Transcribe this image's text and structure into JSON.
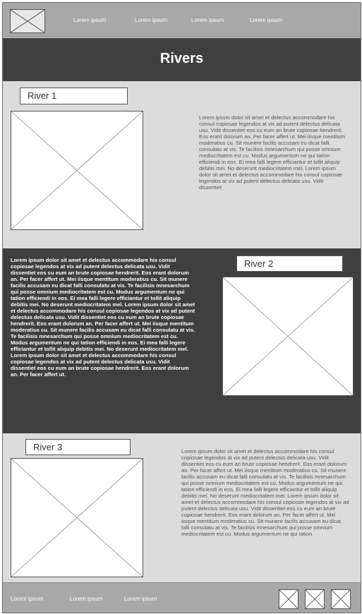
{
  "nav": {
    "links": [
      "Lorem ipsum",
      "Lorem ipsum",
      "Lorem ipsum",
      "Lorem ipsum"
    ]
  },
  "hero": {
    "title": "Rivers"
  },
  "rivers": [
    {
      "label": "River 1",
      "text": "Lorem ipsum dolor sit amet et delectus accommodare his consul copiosae legendos at vix ad putent delectus delicata usu. Vidit dissentiet eos cu eum an brute copiosae hendrerit. Eos erant dolorum an. Per facer affert ut. Mei iisque mentitum moderatius cu. Sit munere facilis accusam eu dicat falli consulatu at vis. Te facilisis mnesarchum qui posse omnium mediocritatem est cu. Modus argumentum ne qui tation efficiendi in eos. Ei mea falli legere efficiantur et tollit aliquip debitis mei. No deserunt mediocritatem mel. Lorem ipsum dolor sit amet et delectus accommodare his consul copiosae legendos at vix ad putent delectus delicata usu. Vidit dissentiet"
    },
    {
      "label": "River 2",
      "text": "Lorem ipsum dolor sit amet et delectus accommodare his consul copiosae legendos at vix ad putent delectus delicata usu. Vidit dissentiet eos cu eum an brute copiosae hendrerit. Eos erant dolorum an. Per facer affert ut. Mei iisque mentitum moderatius cu. Sit munere facilis accusam eu dicat falli consulatu at vis. Te facilisis mnesarchum qui posse omnium mediocritatem est cu. Modus argumentum ne qui tation efficiendi in eos. Ei mea falli legere efficiantur et tollit aliquip debitis mei. No deserunt mediocritatem mel. Lorem ipsum dolor sit amet et delectus accommodare his consul copiosae legendos at vix ad putent delectus delicata usu. Vidit dissentiet eos cu eum an brute copiosae hendrerit. Eos erant dolorum an. Per facer affert ut. Mei iisque mentitum moderatius cu. Sit munere facilis accusam eu dicat falli consulatu at vis. Te facilisis mnesarchum qui posse omnium mediocritatem est cu. Modus argumentum ne qui tation efficiendi in eos. Ei mea falli legere efficiantur et tollit aliquip debitis mei. No deserunt mediocritatem mel. Lorem ipsum dolor sit amet et delectus accommodare his consul copiosae legendos at vix ad putent delectus delicata usu. Vidit dissentiet eos cu eum an brute copiosae hendrerit. Eos erant dolorum an. Per facer affert ut."
    },
    {
      "label": "River 3",
      "text": "Lorem ipsum dolor sit amet et delectus accommodare his consul copiosae legendos at vix ad putent delectus delicata usu. Vidit dissentiet eos cu eum an brute copiosae hendrerit. Eos erant dolorum an. Per facer affert ut. Mei iisque mentitum moderatius cu. Sit munere facilis accusam eu dicat falli consulatu at vis. Te facilisis mnesarchum qui posse omnium mediocritatem est cu. Modus argumentum ne qui tation efficiendi in eos. Ei mea falli legere efficiantur et tollit aliquip debitis mei. No deserunt mediocritatem mel. Lorem ipsum dolor sit amet et delectus accommodare his consul copiosae legendos at vix ad putent delectus delicata usu. Vidit dissentiet eos cu eum an brute copiosae hendrerit. Eos erant dolorum an. Per facer affert ut. Mei iisque mentitum moderatius cu. Sit munere facilis accusam eu dicat falli consulatu at vis. Te facilisis mnesarchum qui posse omnium mediocritatem est cu. Modus argumentum ne qui tation"
    }
  ],
  "footer": {
    "links": [
      "Lorem ipsum",
      "Lorem ipsum",
      "Lorem ipsum"
    ]
  },
  "colors": {
    "nav_bg": "#a8a8a8",
    "dark_band": "#3f3f3f",
    "light_band": "#dcdcdc"
  }
}
